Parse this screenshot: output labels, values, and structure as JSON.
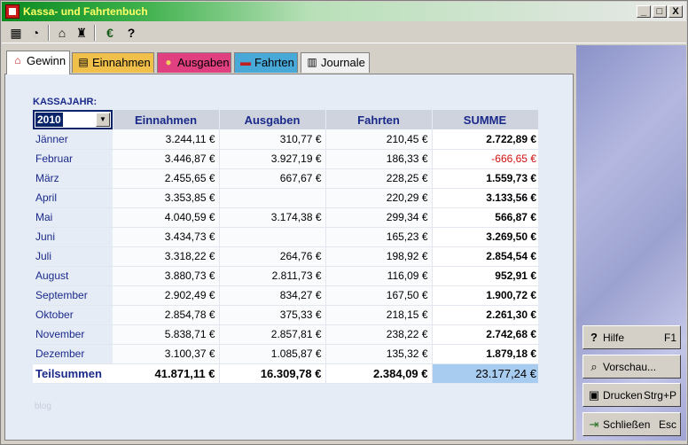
{
  "window": {
    "title": "Kassa- und Fahrtenbuch",
    "controls": [
      "_",
      "□",
      "X"
    ]
  },
  "toolbar": {
    "icons": [
      "calculator-icon",
      "clock-icon",
      "bank-icon",
      "coat-of-arms-icon",
      "euro-icon",
      "help-icon"
    ]
  },
  "tabs": [
    {
      "label": "Gewinn",
      "active": true,
      "color": "#ffffff"
    },
    {
      "label": "Einnahmen",
      "color": "#f0c04a"
    },
    {
      "label": "Ausgaben",
      "color": "#e04080"
    },
    {
      "label": "Fahrten",
      "color": "#48a8d8"
    },
    {
      "label": "Journale",
      "color": "#f0f0f0"
    }
  ],
  "kassajahr_label": "KASSAJAHR:",
  "year_value": "2010",
  "table": {
    "headers": [
      "Einnahmen",
      "Ausgaben",
      "Fahrten",
      "SUMME"
    ],
    "rows": [
      {
        "month": "Jänner",
        "einnahmen": "3.244,11 €",
        "ausgaben": "310,77 €",
        "fahrten": "210,45 €",
        "summe": "2.722,89 €"
      },
      {
        "month": "Februar",
        "einnahmen": "3.446,87 €",
        "ausgaben": "3.927,19 €",
        "fahrten": "186,33 €",
        "summe": "-666,65 €"
      },
      {
        "month": "März",
        "einnahmen": "2.455,65 €",
        "ausgaben": "667,67 €",
        "fahrten": "228,25 €",
        "summe": "1.559,73 €"
      },
      {
        "month": "April",
        "einnahmen": "3.353,85 €",
        "ausgaben": "",
        "fahrten": "220,29 €",
        "summe": "3.133,56 €"
      },
      {
        "month": "Mai",
        "einnahmen": "4.040,59 €",
        "ausgaben": "3.174,38 €",
        "fahrten": "299,34 €",
        "summe": "566,87 €"
      },
      {
        "month": "Juni",
        "einnahmen": "3.434,73 €",
        "ausgaben": "",
        "fahrten": "165,23 €",
        "summe": "3.269,50 €"
      },
      {
        "month": "Juli",
        "einnahmen": "3.318,22 €",
        "ausgaben": "264,76 €",
        "fahrten": "198,92 €",
        "summe": "2.854,54 €"
      },
      {
        "month": "August",
        "einnahmen": "3.880,73 €",
        "ausgaben": "2.811,73 €",
        "fahrten": "116,09 €",
        "summe": "952,91 €"
      },
      {
        "month": "September",
        "einnahmen": "2.902,49 €",
        "ausgaben": "834,27 €",
        "fahrten": "167,50 €",
        "summe": "1.900,72 €"
      },
      {
        "month": "Oktober",
        "einnahmen": "2.854,78 €",
        "ausgaben": "375,33 €",
        "fahrten": "218,15 €",
        "summe": "2.261,30 €"
      },
      {
        "month": "November",
        "einnahmen": "5.838,71 €",
        "ausgaben": "2.857,81 €",
        "fahrten": "238,22 €",
        "summe": "2.742,68 €"
      },
      {
        "month": "Dezember",
        "einnahmen": "3.100,37 €",
        "ausgaben": "1.085,87 €",
        "fahrten": "135,32 €",
        "summe": "1.879,18 €"
      }
    ],
    "total": {
      "label": "Teilsummen",
      "einnahmen": "41.871,11 €",
      "ausgaben": "16.309,78 €",
      "fahrten": "2.384,09 €",
      "summe": "23.177,24 €"
    }
  },
  "watermark": "blog",
  "side_buttons": {
    "hilfe": {
      "label": "Hilfe",
      "key": "F1"
    },
    "vorschau": {
      "label": "Vorschau..."
    },
    "drucken": {
      "label": "Drucken",
      "key": "Strg+P"
    },
    "schliessen": {
      "label": "Schließen",
      "key": "Esc"
    }
  },
  "colors": {
    "negative": "#d01010",
    "header_text": "#1a2a8a",
    "total_highlight": "#a8ccf0"
  }
}
